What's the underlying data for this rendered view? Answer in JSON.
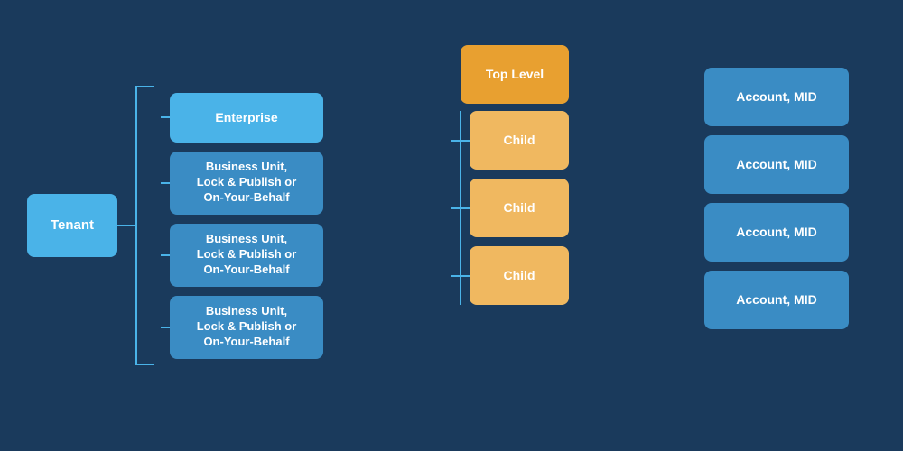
{
  "background_color": "#1a3a5c",
  "nodes": {
    "tenant": {
      "label": "Tenant"
    },
    "enterprise": {
      "label": "Enterprise"
    },
    "business_units": [
      {
        "label": "Business Unit,\nLock & Publish or\nOn-Your-Behalf"
      },
      {
        "label": "Business Unit,\nLock & Publish or\nOn-Your-Behalf"
      },
      {
        "label": "Business Unit,\nLock & Publish or\nOn-Your-Behalf"
      }
    ],
    "top_level": {
      "label": "Top Level"
    },
    "children": [
      {
        "label": "Child"
      },
      {
        "label": "Child"
      },
      {
        "label": "Child"
      }
    ],
    "accounts": [
      {
        "label": "Account, MID"
      },
      {
        "label": "Account, MID"
      },
      {
        "label": "Account, MID"
      },
      {
        "label": "Account, MID"
      }
    ]
  },
  "colors": {
    "blue_light": "#4ab3e8",
    "blue_medium": "#3a8cc4",
    "orange_dark": "#e8a030",
    "orange_light": "#f0b860",
    "connector": "#4ab3e8",
    "text_white": "#ffffff"
  }
}
